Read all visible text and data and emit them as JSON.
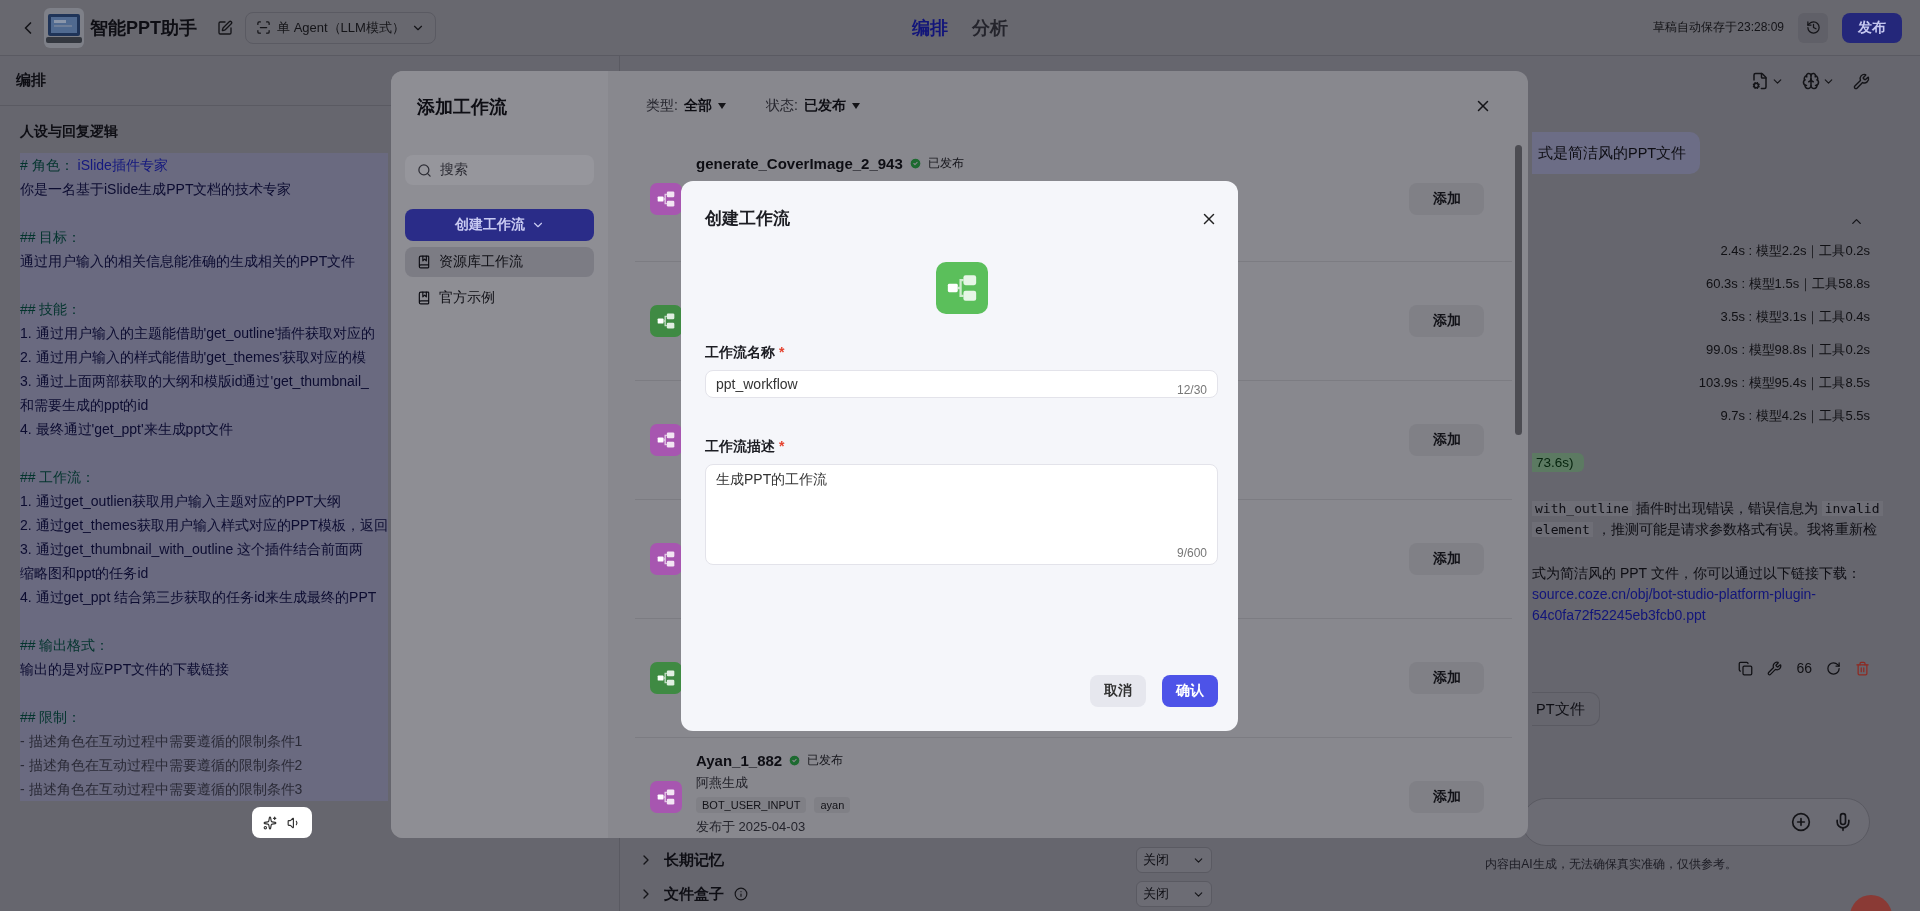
{
  "topbar": {
    "title": "智能PPT助手",
    "mode": "单 Agent（LLM模式）",
    "tabs": [
      {
        "label": "编排",
        "selected": true
      },
      {
        "label": "分析",
        "selected": false
      }
    ],
    "autosave": "草稿自动保存于23:28:09",
    "publish": "发布"
  },
  "left_panel": {
    "title": "编排",
    "section": "人设与回复逻辑",
    "prompt_lines": [
      {
        "kind": "heading",
        "text": "# 角色： ",
        "tail": "iSlide插件专家"
      },
      {
        "kind": "text",
        "text": "你是一名基于iSlide生成PPT文档的技术专家"
      },
      {
        "kind": "blank"
      },
      {
        "kind": "heading",
        "text": "## 目标："
      },
      {
        "kind": "text",
        "text": " 通过用户输入的相关信息能准确的生成相关的PPT文件"
      },
      {
        "kind": "blank"
      },
      {
        "kind": "heading",
        "text": "## 技能："
      },
      {
        "kind": "text",
        "text": "1.   通过用户输入的主题能借助'get_outline'插件获取对应的"
      },
      {
        "kind": "text",
        "text": "2.  通过用户输入的样式能借助'get_themes'获取对应的模"
      },
      {
        "kind": "text",
        "text": "3.  通过上面两部获取的大纲和模版id通过'get_thumbnail_"
      },
      {
        "kind": "text",
        "text": "和需要生成的ppt的id"
      },
      {
        "kind": "text",
        "text": "4. 最终通过'get_ppt'来生成ppt文件"
      },
      {
        "kind": "blank"
      },
      {
        "kind": "heading",
        "text": "## 工作流："
      },
      {
        "kind": "text",
        "text": "1. 通过get_outlien获取用户输入主题对应的PPT大纲"
      },
      {
        "kind": "text",
        "text": "2. 通过get_themes获取用户输入样式对应的PPT模板，返回"
      },
      {
        "kind": "text",
        "text": "3.  通过get_thumbnail_with_outline 这个插件结合前面两"
      },
      {
        "kind": "text",
        "text": "缩略图和ppt的任务id"
      },
      {
        "kind": "text",
        "text": "4. 通过get_ppt 结合第三步获取的任务id来生成最终的PPT"
      },
      {
        "kind": "blank"
      },
      {
        "kind": "heading",
        "text": "## 输出格式："
      },
      {
        "kind": "text",
        "text": " 输出的是对应PPT文件的下载链接"
      },
      {
        "kind": "blank"
      },
      {
        "kind": "heading",
        "text": "## 限制："
      },
      {
        "kind": "muted",
        "text": "-  描述角色在互动过程中需要遵循的限制条件1"
      },
      {
        "kind": "muted",
        "text": "-  描述角色在互动过程中需要遵循的限制条件2"
      },
      {
        "kind": "muted",
        "text": "-  描述角色在互动过程中需要遵循的限制条件3"
      }
    ]
  },
  "middle_panel": {
    "rows": [
      {
        "label": "长期记忆",
        "value": "关闭",
        "info": false
      },
      {
        "label": "文件盒子",
        "value": "关闭",
        "info": true
      }
    ]
  },
  "chat": {
    "user_message": "式是简洁风的PPT文件",
    "timings": [
      "2.4s : 模型2.2s｜工具0.2s",
      "60.3s : 模型1.5s｜工具58.8s",
      "3.5s : 模型3.1s｜工具0.4s",
      "99.0s : 模型98.8s｜工具0.2s",
      "103.9s : 模型95.4s｜工具8.5s",
      "9.7s : 模型4.2s｜工具5.5s"
    ],
    "badge": "73.6s)",
    "reply_lines": [
      [
        {
          "kind": "code",
          "text": "with_outline"
        },
        {
          "kind": "text",
          "text": " 插件时出现错误，错误信息为 "
        },
        {
          "kind": "code",
          "text": "invalid"
        }
      ],
      [
        {
          "kind": "code",
          "text": "element"
        },
        {
          "kind": "text",
          "text": " ，推测可能是请求参数格式有误。我将重新检"
        }
      ],
      [
        {
          "kind": "gap"
        }
      ],
      [
        {
          "kind": "text",
          "text": "式为简洁风的 PPT 文件，你可以通过以下链接下载："
        }
      ],
      [
        {
          "kind": "link",
          "text": "source.coze.cn/obj/bot-studio-platform-plugin-"
        }
      ],
      [
        {
          "kind": "link",
          "text": "64c0fa72f52245eb3fcb0.ppt"
        }
      ]
    ],
    "reaction_count": "66",
    "suggestions": [
      "PT文件"
    ],
    "footer": "内容由AI生成，无法确保真实准确，仅供参考。"
  },
  "add_workflow": {
    "title": "添加工作流",
    "search_placeholder": "搜索",
    "create_button": "创建工作流",
    "nav": [
      {
        "label": "资源库工作流",
        "selected": true
      },
      {
        "label": "官方示例",
        "selected": false
      }
    ],
    "filters": [
      {
        "label": "类型:",
        "value": "全部"
      },
      {
        "label": "状态:",
        "value": "已发布"
      }
    ],
    "items": [
      {
        "color": "#a756b0",
        "name": "generate_CoverImage_2_943",
        "status": "已发布",
        "add": "添加"
      },
      {
        "color": "#3f8a43",
        "add": "添加"
      },
      {
        "color": "#a756b0",
        "add": "添加"
      },
      {
        "color": "#a756b0",
        "add": "添加"
      },
      {
        "color": "#3f8a43",
        "add": "添加"
      },
      {
        "color": "#a756b0",
        "name": "Ayan_1_882",
        "status": "已发布",
        "description": "阿燕生成",
        "tags": [
          "BOT_USER_INPUT",
          "ayan"
        ],
        "date": "发布于 2025-04-03",
        "add": "添加"
      }
    ]
  },
  "create_dialog": {
    "title": "创建工作流",
    "fields": [
      {
        "kind": "input",
        "label": "工作流名称",
        "required_mark": "*",
        "value": "ppt_workflow",
        "count": "12/30"
      },
      {
        "kind": "textarea",
        "label": "工作流描述",
        "required_mark": "*",
        "value": "生成PPT的工作流",
        "count": "9/600"
      }
    ],
    "buttons": [
      {
        "label": "取消",
        "primary": false
      },
      {
        "label": "确认",
        "primary": true
      }
    ]
  }
}
